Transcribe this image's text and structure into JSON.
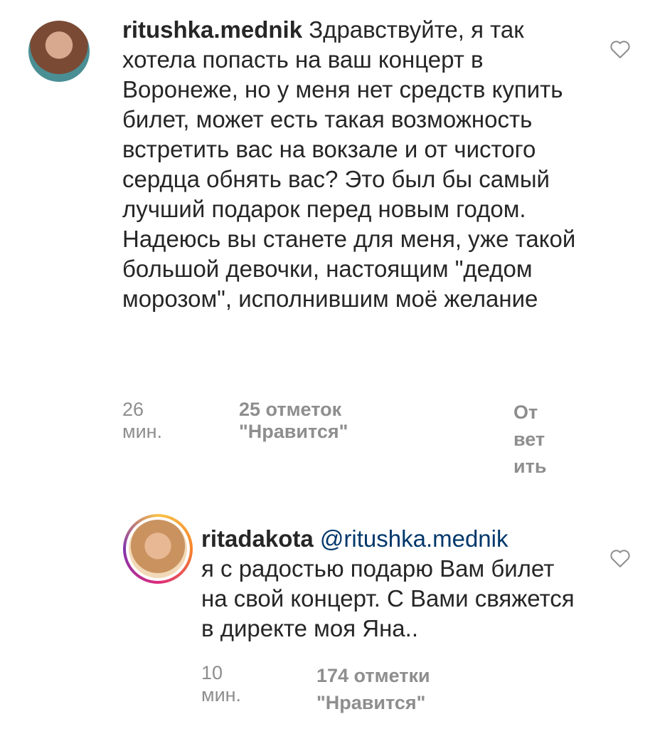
{
  "comments": [
    {
      "username": "ritushka.mednik",
      "text": "Здравствуйте, я так хотела попасть на ваш концерт в Воронеже, но у меня нет средств купить билет, может есть такая возможность встретить вас на вокзале и от чистого сердца обнять вас? Это был бы самый лучший подарок перед новым годом. Надеюсь вы станете для меня, уже такой большой девочки, настоящим \"дедом морозом\", исполнившим моё желание",
      "time": "26 мин.",
      "likes": "25 отметок \"Нравится\"",
      "reply": "Ответить"
    },
    {
      "username": "ritadakota",
      "mention": "@ritushka.mednik",
      "text": "я с радостью подарю Вам билет на свой концерт. С Вами свяжется в директе моя Яна..",
      "time": "10 мин.",
      "likes": "174 отметки \"Нравится\""
    }
  ],
  "icons": {
    "like": "heart-outline-icon"
  },
  "colors": {
    "mention": "#00376b",
    "meta": "#8e8e8e",
    "text": "#262626"
  }
}
